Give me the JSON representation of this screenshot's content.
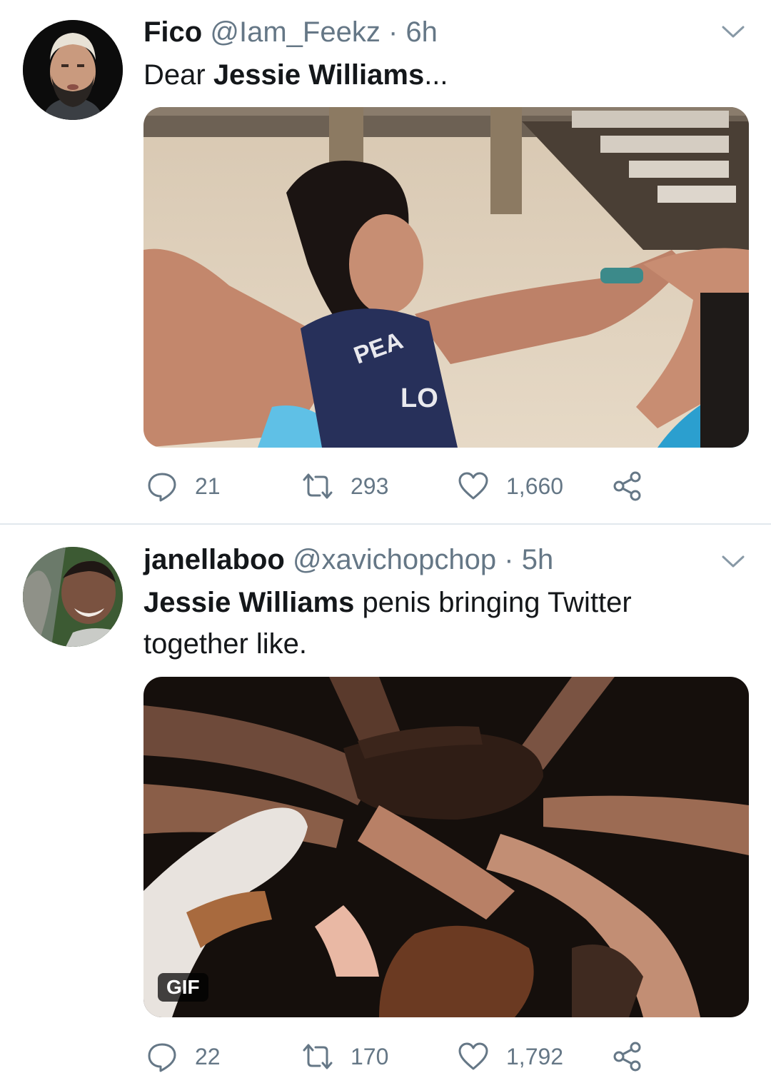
{
  "tweets": [
    {
      "name": "Fico",
      "handle": "@Iam_Feekz",
      "separator": "·",
      "time": "6h",
      "text_plain": "Dear ",
      "text_bold": "Jessie Williams",
      "text_rest": "...",
      "media_type": "image",
      "stats": {
        "replies": "21",
        "retweets": "293",
        "likes": "1,660"
      }
    },
    {
      "name": "janellaboo",
      "handle": "@xavichopchop",
      "separator": "·",
      "time": "5h",
      "text_bold": "Jessie Williams",
      "text_rest": " penis bringing Twitter together like.",
      "media_type": "gif",
      "gif_badge": "GIF",
      "stats": {
        "replies": "22",
        "retweets": "170",
        "likes": "1,792"
      }
    }
  ],
  "icons": {
    "reply": "speech-bubble-icon",
    "retweet": "retweet-arrows-icon",
    "like": "heart-icon",
    "share": "share-nodes-icon",
    "more": "chevron-down-icon"
  },
  "colors": {
    "text": "#14171a",
    "secondary": "#657786",
    "divider": "#e1e8ed"
  }
}
